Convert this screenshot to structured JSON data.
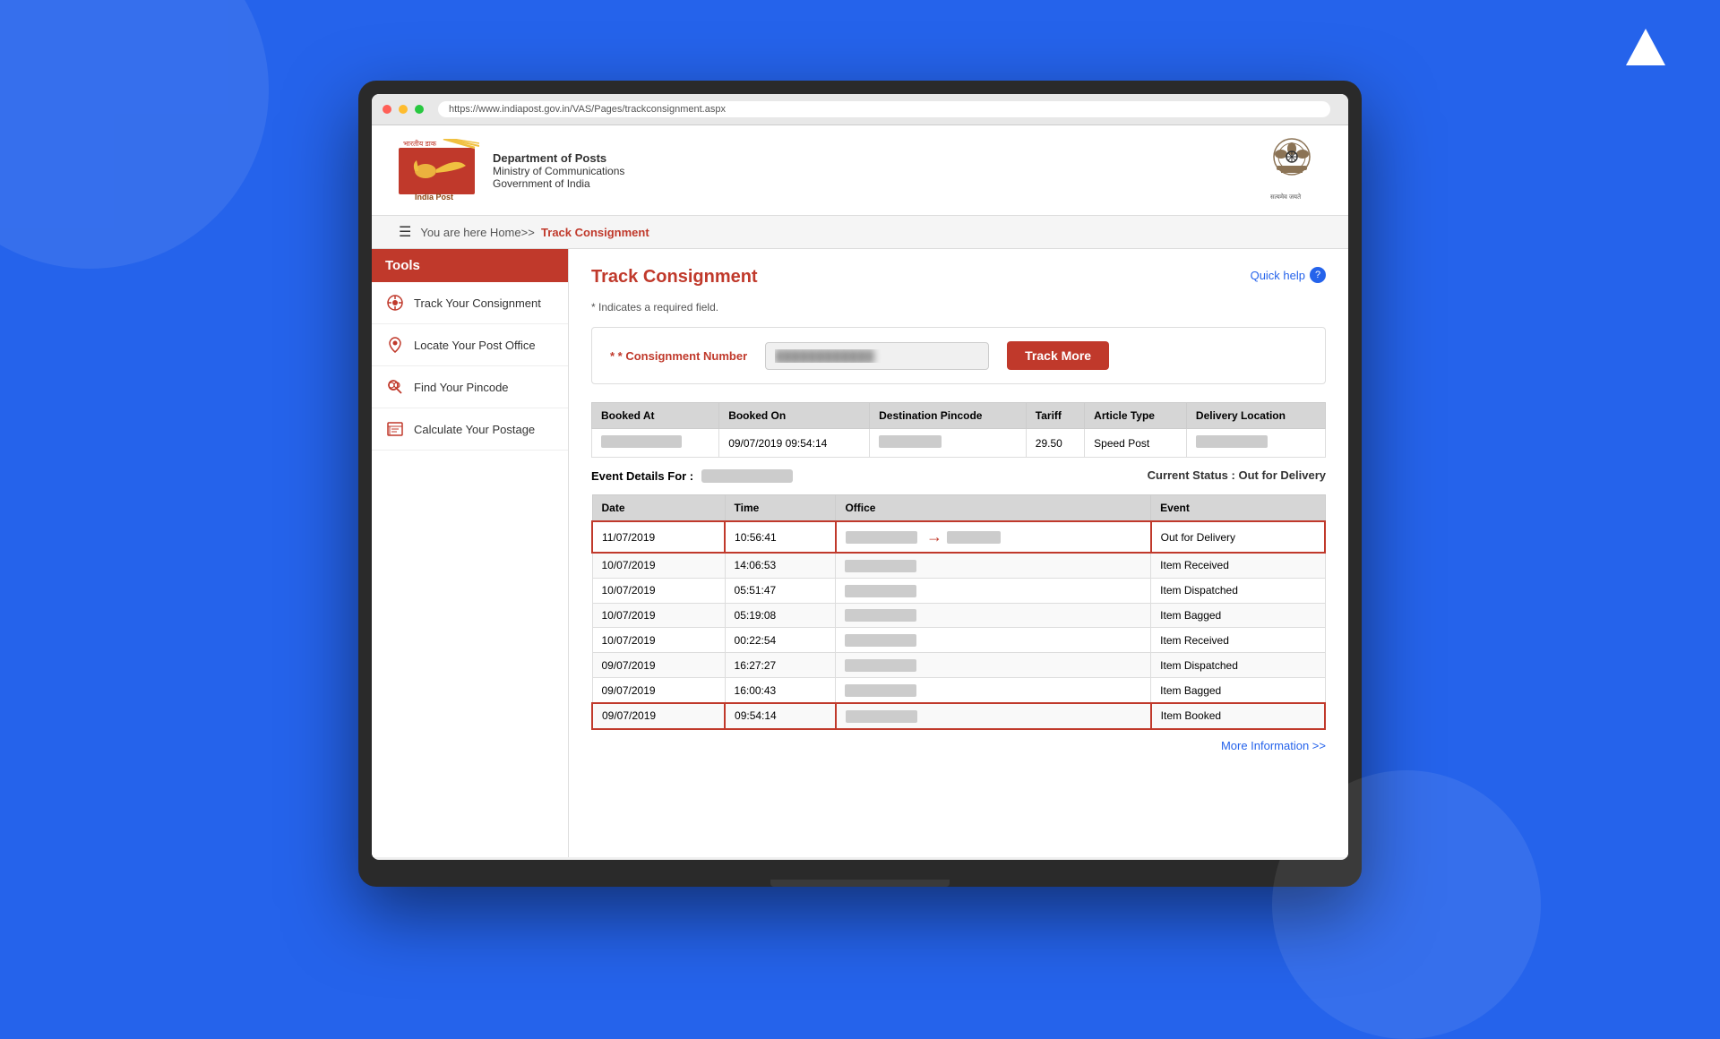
{
  "meta": {
    "bg_color": "#2563eb"
  },
  "header": {
    "hindi_text": "भारतीय डाक",
    "logo_alt": "India Post Logo",
    "india_post_label": "India Post",
    "dept_name": "Department of Posts",
    "ministry_name": "Ministry of Communications",
    "govt_name": "Government of India",
    "ashoka_label": "सत्यमेव जयते"
  },
  "browser": {
    "url": "https://www.indiapost.gov.in/VAS/Pages/trackconsignment.aspx"
  },
  "nav": {
    "breadcrumb_prefix": "You are here Home>>",
    "breadcrumb_current": "Track Consignment"
  },
  "sidebar": {
    "title": "Tools",
    "items": [
      {
        "label": "Track Your Consignment",
        "icon": "⊙"
      },
      {
        "label": "Locate Your Post Office",
        "icon": "📍"
      },
      {
        "label": "Find Your Pincode",
        "icon": "🔍"
      },
      {
        "label": "Calculate Your Postage",
        "icon": "🧮"
      }
    ]
  },
  "content": {
    "page_title": "Track Consignment",
    "quick_help_label": "Quick help",
    "required_note": "* Indicates a required field.",
    "consignment_label": "* Consignment Number",
    "consignment_placeholder": "••••••••••••",
    "track_button": "Track More"
  },
  "summary_table": {
    "headers": [
      "Booked At",
      "Booked On",
      "Destination Pincode",
      "Tariff",
      "Article Type",
      "Delivery Location"
    ],
    "row": {
      "booked_at": "██████████",
      "booked_on": "09/07/2019 09:54:14",
      "dest_pincode": "██████",
      "tariff": "29.50",
      "article_type": "Speed Post",
      "delivery_location": "████████"
    }
  },
  "event_details": {
    "label": "Event Details For :",
    "consignment_blurred": "██████████",
    "current_status_label": "Current Status :",
    "current_status_value": "Out for Delivery"
  },
  "events_table": {
    "headers": [
      "Date",
      "Time",
      "Office",
      "Event"
    ],
    "rows": [
      {
        "date": "11/07/2019",
        "time": "10:56:41",
        "office": "████████████",
        "event": "Out for Delivery",
        "highlighted": true,
        "arrow": true
      },
      {
        "date": "10/07/2019",
        "time": "14:06:53",
        "office": "████████████",
        "event": "Item Received",
        "highlighted": false,
        "arrow": false
      },
      {
        "date": "10/07/2019",
        "time": "05:51:47",
        "office": "████████████",
        "event": "Item Dispatched",
        "highlighted": false,
        "arrow": false
      },
      {
        "date": "10/07/2019",
        "time": "05:19:08",
        "office": "████████████",
        "event": "Item Bagged",
        "highlighted": false,
        "arrow": false
      },
      {
        "date": "10/07/2019",
        "time": "00:22:54",
        "office": "████████████",
        "event": "Item Received",
        "highlighted": false,
        "arrow": false
      },
      {
        "date": "09/07/2019",
        "time": "16:27:27",
        "office": "████████████",
        "event": "Item Dispatched",
        "highlighted": false,
        "arrow": false
      },
      {
        "date": "09/07/2019",
        "time": "16:00:43",
        "office": "████████████",
        "event": "Item Bagged",
        "highlighted": false,
        "arrow": false
      },
      {
        "date": "09/07/2019",
        "time": "09:54:14",
        "office": "████████████",
        "event": "Item Booked",
        "highlighted": true,
        "arrow": false
      }
    ]
  },
  "footer": {
    "more_info": "More Information >>"
  },
  "atlan": {
    "symbol": "▲"
  }
}
